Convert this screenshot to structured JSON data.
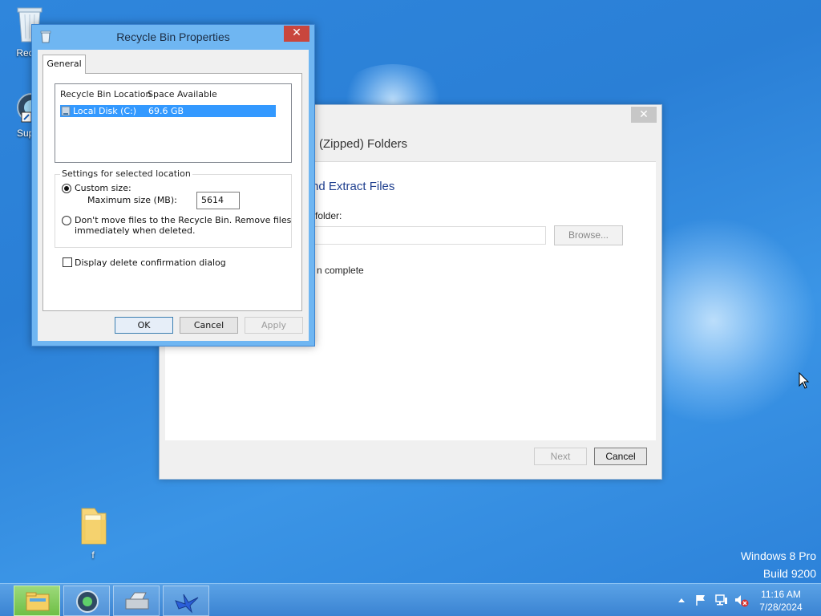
{
  "desktop": {
    "icons": [
      {
        "label": "Recyc"
      },
      {
        "label": "Super"
      },
      {
        "label": "f"
      }
    ],
    "branding": {
      "line1": "Windows 8 Pro",
      "line2": "Build 9200"
    }
  },
  "wizard": {
    "close_glyph": "✕",
    "title": "(Zipped) Folders",
    "heading": "nd Extract Files",
    "folder_label": "folder:",
    "folder_value": "",
    "browse_label": "Browse...",
    "checkbox_label": "n complete",
    "next_label": "Next",
    "cancel_label": "Cancel"
  },
  "dialog": {
    "title": "Recycle Bin Properties",
    "close_glyph": "✕",
    "tab": "General",
    "list": {
      "col1": "Recycle Bin Location",
      "col2": "Space Available",
      "rows": [
        {
          "location": "Local Disk (C:)",
          "space": "69.6 GB",
          "selected": true
        }
      ]
    },
    "group_title": "Settings for selected location",
    "custom_size_label": "Custom size:",
    "max_size_label": "Maximum size (MB):",
    "max_size_value": "5614",
    "dont_move_line1": "Don't move files to the Recycle Bin. Remove files",
    "dont_move_line2": "immediately when deleted.",
    "custom_size_selected": true,
    "confirm_label": "Display delete confirmation dialog",
    "confirm_checked": false,
    "ok_label": "OK",
    "cancel_label": "Cancel",
    "apply_label": "Apply"
  },
  "taskbar": {
    "buttons": [
      {
        "name": "file-explorer",
        "active": true
      },
      {
        "name": "media-app",
        "active": false
      },
      {
        "name": "scanner-app",
        "active": false
      },
      {
        "name": "bird-app",
        "active": false
      }
    ],
    "tray_icons": [
      "chevron-up-icon",
      "flag-icon",
      "network-icon",
      "volume-muted-icon"
    ],
    "time": "11:16 AM",
    "date": "7/28/2024"
  },
  "colors": {
    "accent": "#3399ff",
    "desktop": "#2f86dc",
    "close_red": "#c9463d"
  }
}
